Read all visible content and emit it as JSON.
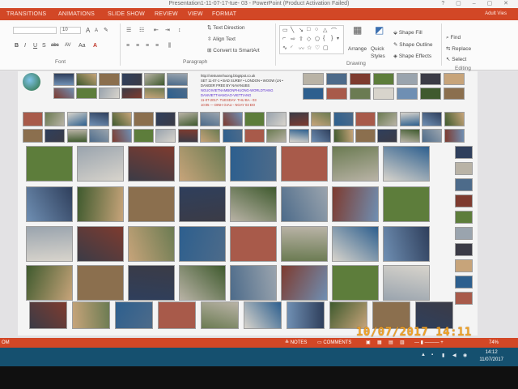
{
  "window": {
    "title": "Presentation1-11-07-17-tue- 03  -  PowerPoint (Product Activation Failed)",
    "controls": "? ▢ – ▢ ✕"
  },
  "ribbon_tabs": [
    "TRANSITIONS",
    "ANIMATIONS",
    "SLIDE SHOW",
    "REVIEW",
    "VIEW",
    "FORMAT"
  ],
  "user": "Adult Vies",
  "ribbon": {
    "font": {
      "label": "Font",
      "size": "10",
      "bold": "B",
      "italic": "I",
      "underline": "U",
      "strike": "S",
      "abc": "abc",
      "spacing": "AV",
      "case": "Aa",
      "grow": "A",
      "shrink": "A"
    },
    "paragraph": {
      "label": "Paragraph",
      "text_direction": "Text Direction",
      "align_text": "Align Text",
      "smartart": "Convert to SmartArt"
    },
    "drawing": {
      "label": "Drawing",
      "arrange": "Arrange",
      "quick_styles": "Quick Styles",
      "shape_fill": "Shape Fill",
      "shape_outline": "Shape Outline",
      "shape_effects": "Shape Effects"
    },
    "editing": {
      "label": "Editing",
      "find": "Find",
      "replace": "Replace",
      "select": "Select"
    }
  },
  "slide_info_lines": [
    {
      "text": "http://vietnamnhuong.blogspot.co.uk",
      "color": "#333333"
    },
    {
      "text": "SET 11-07-1 • BAD SURBY • LONDON • WOOW (LN •",
      "color": "#333333"
    },
    {
      "text": "DANGER FREE BY NAVANUBS",
      "color": "#333333"
    },
    {
      "text": "NGUOIVIETNAMBONPHUONG-WORLDTIANG",
      "color": "#5a2bd0"
    },
    {
      "text": "DANVIETTHANGAO-VIETTIANG",
      "color": "#5a2bd0"
    },
    {
      "text": "11-07-2017- TUESDAY- THU BA - 03",
      "color": "#c0392b"
    },
    {
      "text": "10:05 — DINH GIAU - NGAY 03 ĐO",
      "color": "#c0392b"
    }
  ],
  "statusbar": {
    "left": "ОМ",
    "notes": "NOTES",
    "comments": "COMMENTS",
    "zoom": "74%"
  },
  "taskbar": {
    "time": "14:12",
    "date": "11/07/2017"
  },
  "camera_stamp": "10/07/2017  14:11"
}
